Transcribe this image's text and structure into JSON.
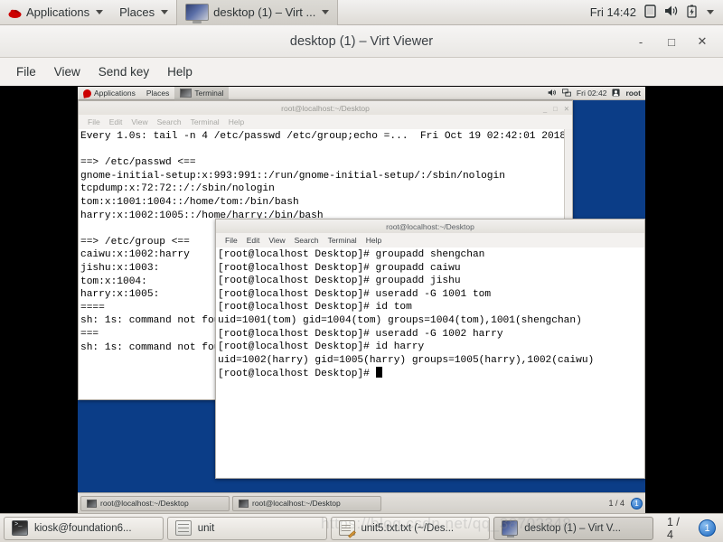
{
  "host_panel": {
    "applications": "Applications",
    "places": "Places",
    "window_title": "desktop (1) – Virt ...",
    "clock": "Fri 14:42",
    "icons": [
      "display-icon",
      "volume-icon",
      "battery-icon",
      "caret-down-icon"
    ]
  },
  "virt_viewer": {
    "title": "desktop (1) – Virt Viewer",
    "minimize": "-",
    "maximize": "□",
    "close": "✕",
    "menu": [
      "File",
      "View",
      "Send key",
      "Help"
    ]
  },
  "vm": {
    "top_panel": {
      "applications": "Applications",
      "places": "Places",
      "active_window": "Terminal",
      "clock": "Fri 02:42",
      "user": "root"
    },
    "background_terminal": {
      "title": "root@localhost:~/Desktop",
      "menu": [
        "File",
        "Edit",
        "View",
        "Search",
        "Terminal",
        "Help"
      ],
      "lines": [
        "Every 1.0s: tail -n 4 /etc/passwd /etc/group;echo =...  Fri Oct 19 02:42:01 2018",
        "",
        "==> /etc/passwd <==",
        "gnome-initial-setup:x:993:991::/run/gnome-initial-setup/:/sbin/nologin",
        "tcpdump:x:72:72::/:/sbin/nologin",
        "tom:x:1001:1004::/home/tom:/bin/bash",
        "harry:x:1002:1005::/home/harry:/bin/bash",
        "",
        "==> /etc/group <==",
        "caiwu:x:1002:harry",
        "jishu:x:1003:",
        "tom:x:1004:",
        "harry:x:1005:",
        "====",
        "sh: 1s: command not found",
        "===",
        "sh: 1s: command not found"
      ]
    },
    "foreground_terminal": {
      "title": "root@localhost:~/Desktop",
      "menu": [
        "File",
        "Edit",
        "View",
        "Search",
        "Terminal",
        "Help"
      ],
      "lines": [
        "[root@localhost Desktop]# groupadd shengchan",
        "[root@localhost Desktop]# groupadd caiwu",
        "[root@localhost Desktop]# groupadd jishu",
        "[root@localhost Desktop]# useradd -G 1001 tom",
        "[root@localhost Desktop]# id tom",
        "uid=1001(tom) gid=1004(tom) groups=1004(tom),1001(shengchan)",
        "[root@localhost Desktop]# useradd -G 1002 harry",
        "[root@localhost Desktop]# id harry",
        "uid=1002(harry) gid=1005(harry) groups=1005(harry),1002(caiwu)",
        "[root@localhost Desktop]# "
      ]
    },
    "taskbar": {
      "tasks": [
        "root@localhost:~/Desktop",
        "root@localhost:~/Desktop"
      ],
      "pager": "1 / 4",
      "workspace_badge": "1"
    }
  },
  "host_taskbar": {
    "tasks": [
      {
        "label": "kiosk@foundation6...",
        "icon": "terminal-icon",
        "selected": false
      },
      {
        "label": "unit",
        "icon": "archive-icon",
        "selected": false
      },
      {
        "label": "unit5.txt.txt (~/Des...",
        "icon": "text-editor-icon",
        "selected": false
      },
      {
        "label": "desktop (1) – Virt V...",
        "icon": "monitor-icon",
        "selected": true
      }
    ],
    "pager": "1 / 4",
    "workspace_badge": "1"
  },
  "watermark": "https://blog.csdn.net/qq_38702348",
  "colors": {
    "desktop_blue": "#0b3d87",
    "panel_grey": "#e8e6e3",
    "terminal_bg": "#ffffff",
    "terminal_fg": "#000000"
  }
}
